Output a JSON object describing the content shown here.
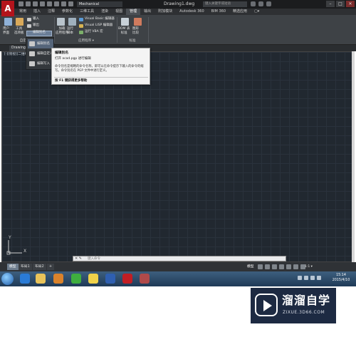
{
  "titlebar": {
    "app_logo": "A",
    "workspace": "Mechanical",
    "document_title": "Drawing1.dwg",
    "search_placeholder": "键入关键字或短语",
    "min": "–",
    "max": "□",
    "close": "✕"
  },
  "ribbon_tabs": [
    "常用",
    "插入",
    "注释",
    "参数化",
    "三维工具",
    "渲染",
    "视图",
    "管理",
    "输出",
    "附加模块",
    "Autodesk 360",
    "BIM 360",
    "精选应用",
    "▢▾"
  ],
  "active_tab": "管理",
  "ribbon": {
    "btn_user_interface": "用户\n界面",
    "btn_tool_palette": "工具\n选项板",
    "btn_import": "输入",
    "btn_export": "输出",
    "btn_edit_alias": "编辑别名",
    "btn_load_app": "加载\n应用程序",
    "btn_run_script": "运行\n脚本",
    "btn_vb_editor": "Visual Basic 编辑器",
    "btn_vlisp_editor": "Visual LISP 编辑器",
    "btn_run_vba": "运行 VBA 宏",
    "btn_bom": "BOM 表\n标准",
    "btn_compare": "图形\n比较",
    "group_customize": "自定义设置",
    "group_apps": "应用程序 ▾",
    "group_standards": "标准"
  },
  "dropdown": {
    "items": [
      "编辑别名",
      "编辑自定义",
      "编辑写入"
    ]
  },
  "tooltip": {
    "title": "编辑别名",
    "subtitle": "打开 acad.pgp 进行编辑",
    "description": "命令别名是缩略的命令名称，即可以在命令提示下输入的命令的缩写。命令别名在 PGP 文件中进行定义。",
    "help": "按 F1 键获得更多帮助"
  },
  "file_tab": {
    "name": "Drawing1",
    "close": "×"
  },
  "drawing": {
    "view_label": "[-][俯视][二维线框]",
    "ucs_x": "X",
    "ucs_y": "Y"
  },
  "command_line": {
    "close": "✕ ✎",
    "prompt": "键入命令"
  },
  "layout_tabs": [
    "模型",
    "布局1",
    "布局2",
    "+"
  ],
  "active_layout": "模型",
  "statusbar": {
    "model": "模型",
    "scale": "1:1 ▾"
  },
  "taskbar": {
    "time": "15:14",
    "date": "2015/4/10",
    "apps": [
      "ie-icon",
      "folder-icon",
      "media-icon",
      "wechat-icon",
      "qq-icon",
      "word-icon",
      "autocad-icon",
      "other-icon"
    ]
  },
  "watermark": {
    "brand": "溜溜自学",
    "url": "ZIXUE.3D66.COM"
  },
  "colors": {
    "drawing_bg": "#212830",
    "ribbon_bg": "#3e4246",
    "title_bg": "#1b1c1e",
    "brand_red": "#b3141c",
    "watermark_bg": "#1d2a42"
  }
}
